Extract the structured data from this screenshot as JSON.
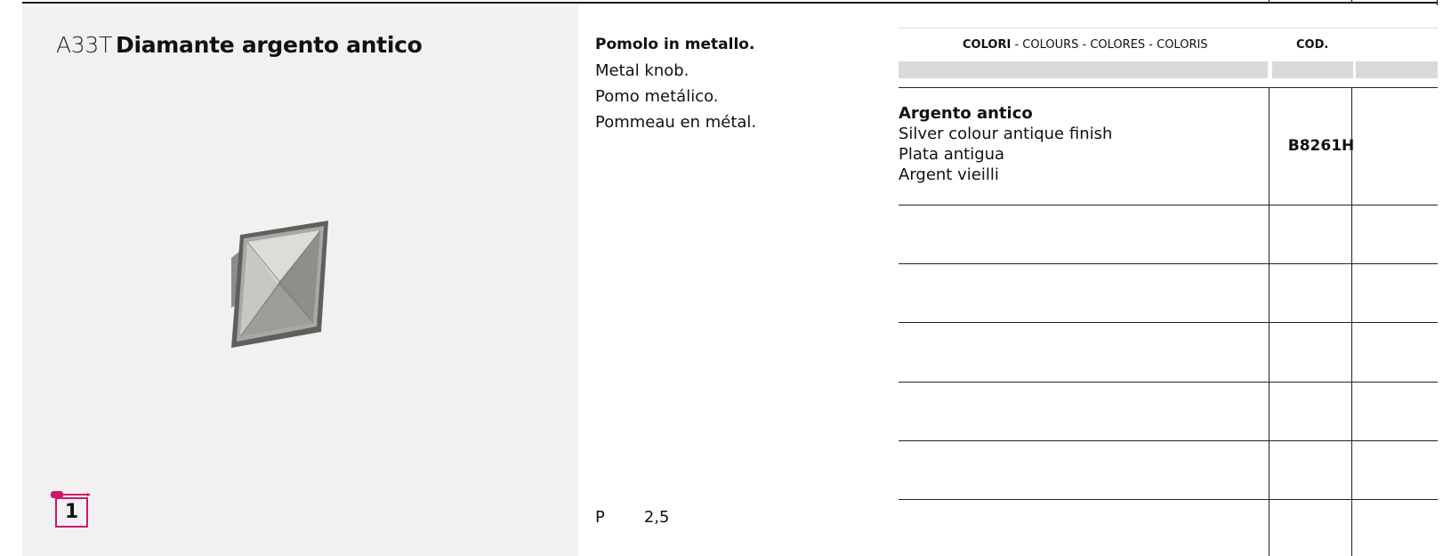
{
  "product": {
    "code": "A33T",
    "name": "Diamante argento antico"
  },
  "description": {
    "lines": [
      "Pomolo in metallo.",
      "Metal knob.",
      "Pomo metálico.",
      "Pommeau en métal."
    ]
  },
  "badge": {
    "number": "1"
  },
  "weight": {
    "label": "P",
    "value": "2,5"
  },
  "table": {
    "header_bold": "COLORI",
    "header_rest": " - COLOURS - COLORES - COLORIS",
    "cod_header": "COD.",
    "rows": [
      {
        "name": "Argento antico",
        "translations": [
          "Silver colour antique finish",
          "Plata antigua",
          "Argent vieilli"
        ],
        "code": "B8261H"
      }
    ]
  },
  "colors": {
    "accent": "#d1166c",
    "panel": "#f0f1f0"
  }
}
